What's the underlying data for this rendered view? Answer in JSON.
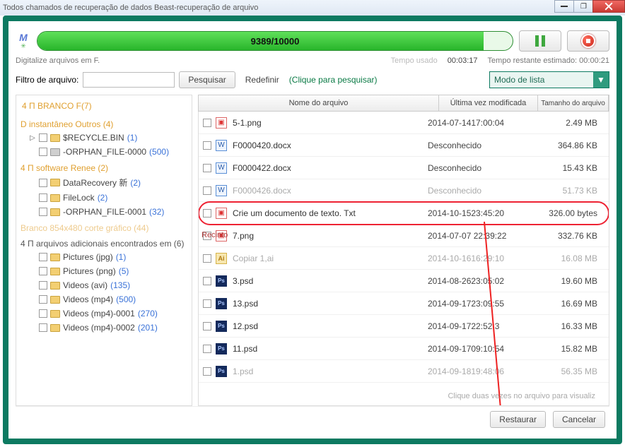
{
  "window_title": "Todos chamados de recuperação de dados Beast-recuperação de arquivo",
  "progress_text": "9389/10000",
  "scan_label": "Digitalize arquivos em F.",
  "time_used_label": "Tempo usado",
  "time_used_value": "00:03:17",
  "time_remain_label": "Tempo restante estimado: 00:00:21",
  "filter_label": "Filtro de arquivo:",
  "search_btn": "Pesquisar",
  "reset_btn": "Redefinir",
  "search_hint": "(Clique para pesquisar)",
  "view_mode": "Modo de lista",
  "tree": {
    "root": "4 Π BRANCO F(7)",
    "sections": [
      {
        "label": "D instantâneo Outros (4)",
        "kind": "section-o",
        "children": [
          {
            "label": "$RECYCLE.BIN",
            "count": "(1)",
            "icon": "dollar",
            "expander": "▷"
          },
          {
            "label": "-ORPHAN_FILE-0000",
            "count": "(500)",
            "icon": "gray"
          }
        ]
      },
      {
        "label": "4 Π software Renee (2)",
        "kind": "section-o",
        "children": [
          {
            "label": "DataRecovery 新",
            "count": "(2)",
            "icon": "folder"
          },
          {
            "label": "FileLock",
            "count": "(2)",
            "icon": "folder"
          },
          {
            "label": "-ORPHAN_FILE-0001",
            "count": "(32)",
            "icon": "folder"
          }
        ]
      },
      {
        "label": "Branco 854x480 corte gráfico (44)",
        "kind": "section-muted"
      },
      {
        "label": "4 Π arquivos adicionais encontrados em (6)",
        "kind": "section-plain",
        "children": [
          {
            "label": "Pictures (jpg)",
            "count": "(1)"
          },
          {
            "label": "Pictures (png)",
            "count": "(5)"
          },
          {
            "label": "Videos (avi)",
            "count": "(135)"
          },
          {
            "label": "Videos (mp4)",
            "count": "(500)"
          },
          {
            "label": "Videos (mp4)-0001",
            "count": "(270)"
          },
          {
            "label": "Videos (mp4)-0002",
            "count": "(201)"
          }
        ]
      }
    ]
  },
  "columns": {
    "name": "Nome do arquivo",
    "mod": "Última vez modificada",
    "size": "Tamanho do arquivo"
  },
  "recinto_label": "Recinto",
  "files": [
    {
      "ico": "img",
      "name": "5-1.png",
      "time": "2014-07-1417:00:04",
      "size": "2.49 MB"
    },
    {
      "ico": "doc",
      "name": "F0000420.docx",
      "time": "Desconhecido",
      "size": "364.86 KB"
    },
    {
      "ico": "doc",
      "name": "F0000422.docx",
      "time": "Desconhecido",
      "size": "15.43 KB"
    },
    {
      "ico": "doc",
      "name": "F0000426.docx",
      "time": "Desconhecido",
      "size": "51.73 KB",
      "muted": true
    },
    {
      "ico": "img",
      "name": "Crie um documento de texto. Txt",
      "time": "2014-10-1523:45:20",
      "size": "326.00 bytes",
      "hl": true
    },
    {
      "ico": "img",
      "name": "7.png",
      "time": "2014-07-07 22:39:22",
      "size": "332.76 KB",
      "recinto": true
    },
    {
      "ico": "ai",
      "name": "Copiar 1,ai",
      "time": "2014-10-1616:29:10",
      "size": "16.08 MB",
      "muted": true
    },
    {
      "ico": "psd",
      "name": "3.psd",
      "time": "2014-08-2623:05:02",
      "size": "19.60 MB"
    },
    {
      "ico": "psd",
      "name": "13.psd",
      "time": "2014-09-1723:09:55",
      "size": "16.69 MB"
    },
    {
      "ico": "psd",
      "name": "12.psd",
      "time": "2014-09-1722:52:3",
      "size": "16.33 MB"
    },
    {
      "ico": "psd",
      "name": "11.psd",
      "time": "2014-09-1709:10:54",
      "size": "15.82 MB"
    },
    {
      "ico": "psd",
      "name": "1.psd",
      "time": "2014-09-1819:48:06",
      "size": "56.35 MB",
      "muted": true
    }
  ],
  "dbl_hint": "Clique duas vezes no arquivo para visualiz",
  "restore_btn": "Restaurar",
  "cancel_btn": "Cancelar"
}
